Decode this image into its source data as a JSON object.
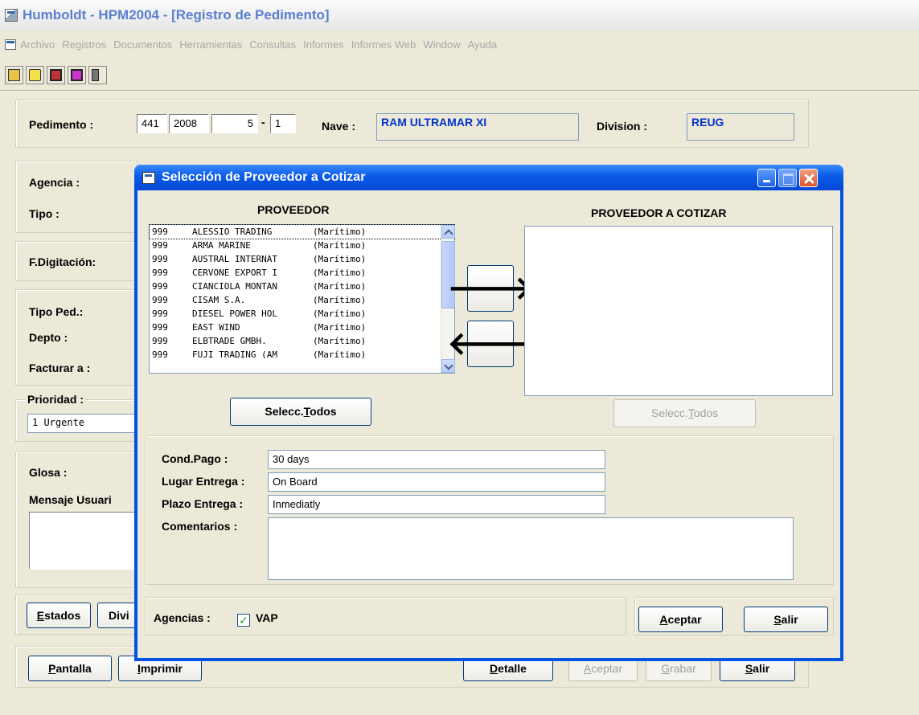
{
  "window": {
    "title": "Humboldt - HPM2004 - [Registro de Pedimento]"
  },
  "menu": [
    "Archivo",
    "Registros",
    "Documentos",
    "Herramientas",
    "Consultas",
    "Informes",
    "Informes Web",
    "Window",
    "Ayuda"
  ],
  "toolbar_icons": [
    "open-icon",
    "print-preview-icon",
    "save-icon",
    "stop-icon",
    "exit-door-icon"
  ],
  "pedimento": {
    "label": "Pedimento :",
    "num1": "441",
    "num2": "2008",
    "num3": "5",
    "dash": "-",
    "num4": "1",
    "nave_label": "Nave :",
    "nave": "RAM ULTRAMAR XI",
    "division_label": "Division :",
    "division": "REUG"
  },
  "labels": {
    "agencia": "Agencia :",
    "tipo": "Tipo :",
    "fdigitacion": "F.Digitación:",
    "tipo_ped": "Tipo Ped.:",
    "depto": "Depto :",
    "facturar": "Facturar a :",
    "prioridad": "Prioridad :",
    "glosa": "Glosa :",
    "mensaje": "Mensaje Usuari"
  },
  "prioridad_value": "1 Urgente",
  "bottom": {
    "estados_u": "E",
    "estados_rest": "stados",
    "divi": "Divi",
    "pantalla_u": "P",
    "pantalla_rest": "antalla",
    "imprimir_u": "I",
    "imprimir_rest": "mprimir",
    "detalle_u": "D",
    "detalle_rest": "etalle",
    "aceptar_u": "A",
    "aceptar_rest": "ceptar",
    "grabar_u": "G",
    "grabar_rest": "rabar",
    "salir_u": "S",
    "salir_rest": "alir"
  },
  "dialog": {
    "title": "Selección de Proveedor a Cotizar",
    "left_header": "PROVEEDOR",
    "right_header": "PROVEEDOR A COTIZAR",
    "proveedores": [
      {
        "code": "999",
        "name": "ALESSIO TRADING",
        "type": "(Marítimo)"
      },
      {
        "code": "999",
        "name": "ARMA MARINE",
        "type": "(Marítimo)"
      },
      {
        "code": "999",
        "name": "AUSTRAL INTERNAT",
        "type": "(Marítimo)"
      },
      {
        "code": "999",
        "name": "CERVONE EXPORT I",
        "type": "(Marítimo)"
      },
      {
        "code": "999",
        "name": "CIANCIOLA MONTAN",
        "type": "(Marítimo)"
      },
      {
        "code": "999",
        "name": "CISAM S.A.",
        "type": "(Marítimo)"
      },
      {
        "code": "999",
        "name": "DIESEL POWER HOL",
        "type": "(Marítimo)"
      },
      {
        "code": "999",
        "name": "EAST WIND",
        "type": "(Marítimo)"
      },
      {
        "code": "999",
        "name": "ELBTRADE GMBH.",
        "type": "(Marítimo)"
      },
      {
        "code": "999",
        "name": "FUJI TRADING (AM",
        "type": "(Marítimo)"
      }
    ],
    "add_arrow": "🡒",
    "remove_arrow": "🡐",
    "selecc_pre": "Selecc.",
    "selecc_u": "T",
    "selecc_rest": "odos",
    "cond_pago_label": "Cond.Pago :",
    "cond_pago": "30 days",
    "lugar_label": "Lugar Entrega :",
    "lugar": "On Board",
    "plazo_label": "Plazo Entrega :",
    "plazo": "Inmediatly",
    "comentarios_label": "Comentarios :",
    "comentarios": "",
    "agencias_label": "Agencias :",
    "agencia_check": "✓",
    "agencia_name": "VAP",
    "aceptar_u": "A",
    "aceptar_rest": "ceptar",
    "salir_u": "S",
    "salir_rest": "alir"
  }
}
